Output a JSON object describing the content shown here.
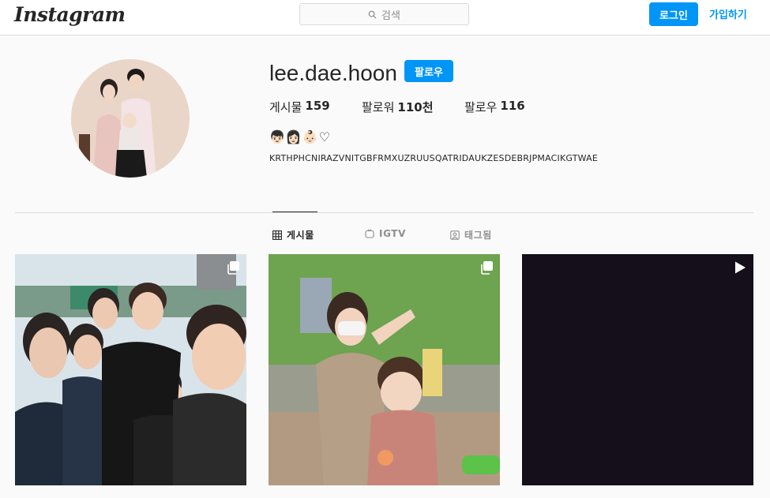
{
  "header": {
    "logo_text": "Instagram",
    "search_placeholder": "검색",
    "login_label": "로그인",
    "signup_label": "가입하기"
  },
  "profile": {
    "username": "lee.dae.hoon",
    "follow_label": "팔로우",
    "stats": [
      {
        "label": "게시물",
        "value": "159"
      },
      {
        "label": "팔로워",
        "value": "110천"
      },
      {
        "label": "팔로우",
        "value": "116"
      }
    ],
    "bio_emoji": "👦🏻👩🏻👶🏻♡",
    "bio_text": "KRTHPHCNIRAZVNITGBFRMXUZRUUSQATRIDAUKZESDEBRJPMACIKGTWAE"
  },
  "tabs": [
    {
      "label": "게시물",
      "icon": "grid-icon",
      "active": true
    },
    {
      "label": "IGTV",
      "icon": "igtv-icon",
      "active": false
    },
    {
      "label": "태그됨",
      "icon": "tagged-icon",
      "active": false
    }
  ],
  "posts": [
    {
      "type": "carousel",
      "badge_icon": "carousel-icon"
    },
    {
      "type": "carousel",
      "badge_icon": "carousel-icon"
    },
    {
      "type": "video",
      "badge_icon": "play-icon"
    }
  ],
  "colors": {
    "accent": "#0095f6",
    "border": "#dbdbdb",
    "muted": "#8e8e8e",
    "background": "#fafafa"
  }
}
